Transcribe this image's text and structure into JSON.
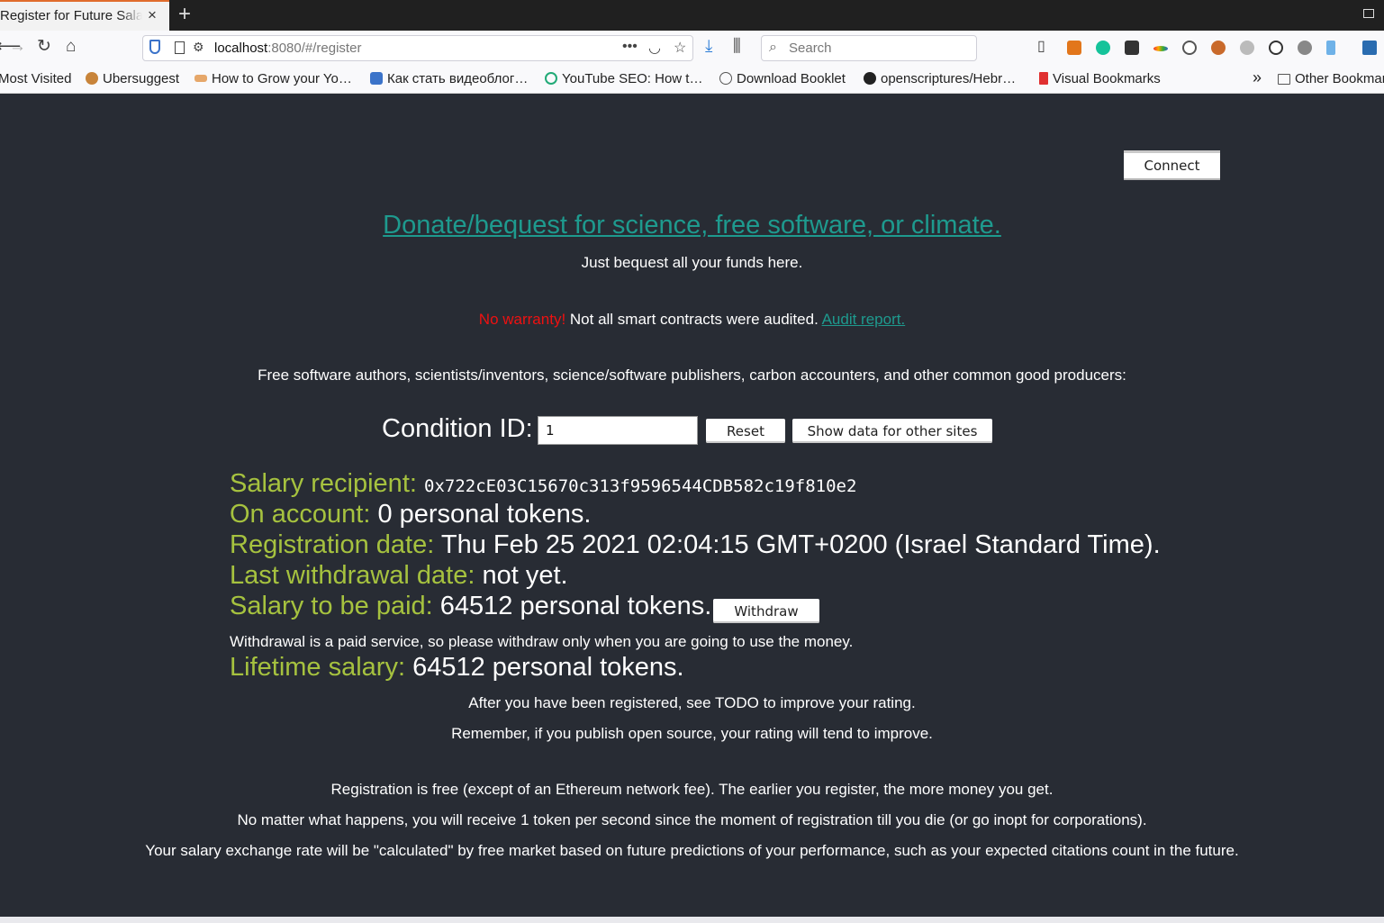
{
  "browser": {
    "tab_title": "Register for Future Salary",
    "tab_close": "×",
    "new_tab": "+",
    "url_host": "localhost",
    "url_rest": ":8080/#/register",
    "search_placeholder": "Search",
    "bookmarks": [
      {
        "label": "Most Visited",
        "icon": "gear-icon",
        "color": "#666666"
      },
      {
        "label": "Ubersuggest",
        "icon": "ubersuggest-icon",
        "color": "#c8843a"
      },
      {
        "label": "How to Grow your Yo…",
        "icon": "bookmark-icon",
        "color": "#e6a76a"
      },
      {
        "label": "Как стать видеоблог…",
        "icon": "w-icon",
        "color": "#3b73c9"
      },
      {
        "label": "YouTube SEO: How t…",
        "icon": "circle-icon",
        "color": "#22aa77"
      },
      {
        "label": "Download Booklet",
        "icon": "globe-icon",
        "color": "#555555"
      },
      {
        "label": "openscriptures/Hebr…",
        "icon": "github-icon",
        "color": "#222222"
      },
      {
        "label": "Visual Bookmarks",
        "icon": "bookmark-icon",
        "color": "#e03030"
      }
    ],
    "overflow": "»",
    "other_bookmarks": "Other Bookmarks"
  },
  "page": {
    "connect_label": "Connect",
    "donate_link": "Donate/bequest for science, free software, or climate.",
    "bequest_text": "Just bequest all your funds here.",
    "warranty_red": "No warranty!",
    "warranty_text": " Not all smart contracts were audited. ",
    "audit_link": "Audit report.",
    "audience_text": "Free software authors, scientists/inventors, science/software publishers, carbon accounters, and other common good producers:",
    "condition_label": "Condition ID:",
    "condition_value": "1",
    "reset_label": "Reset",
    "show_data_label": "Show data for other sites",
    "recipient_label": "Salary recipient:",
    "recipient_value": "0x722cE03C15670c313f9596544CDB582c19f810e2",
    "account_label": "On account:",
    "account_value": "0 personal tokens.",
    "regdate_label": "Registration date:",
    "regdate_value": "Thu Feb 25 2021 02:04:15 GMT+0200 (Israel Standard Time).",
    "withdrawal_label": "Last withdrawal date:",
    "withdrawal_value": "not yet.",
    "topay_label": "Salary to be paid:",
    "topay_value": "64512 personal tokens.",
    "withdraw_label": "Withdraw",
    "withdraw_note": "Withdrawal is a paid service, so please withdraw only when you are going to use the money.",
    "lifetime_label": "Lifetime salary:",
    "lifetime_value": "64512 personal tokens.",
    "todo_text": "After you have been registered, see TODO to improve your rating.",
    "opensource_text": "Remember, if you publish open source, your rating will tend to improve.",
    "free_text": "Registration is free (except of an Ethereum network fee). The earlier you register, the more money you get.",
    "token_text": "No matter what happens, you will receive 1 token per second since the moment of registration till you die (or go inopt for corporations).",
    "rate_text": "Your salary exchange rate will be \"calculated\" by free market based on future predictions of your performance, such as your expected citations count in the future."
  },
  "colors": {
    "background": "#282c34",
    "label_green": "#a6c23f",
    "link_teal": "#1e9a8e",
    "warning_red": "#ee1111"
  }
}
